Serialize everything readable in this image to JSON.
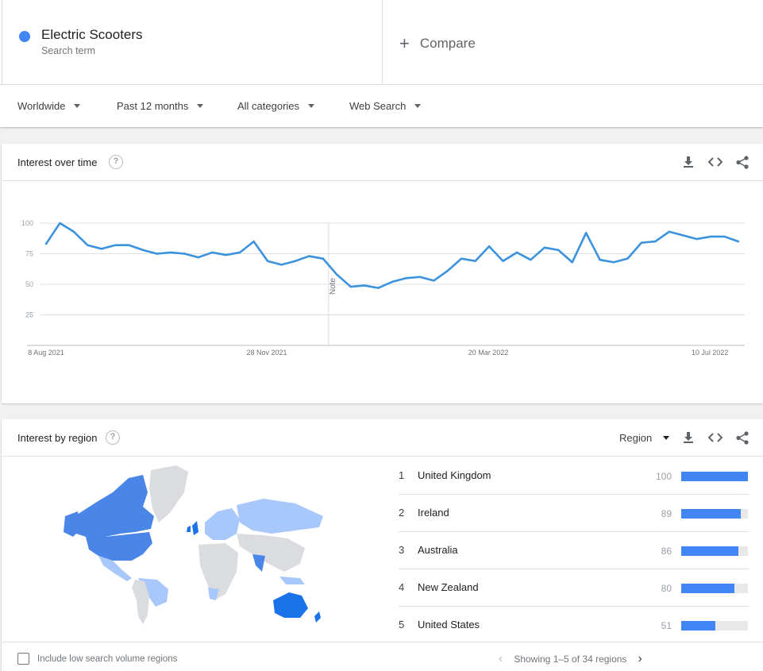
{
  "search_term": {
    "name": "Electric Scooters",
    "subtitle": "Search term",
    "color": "#4285f4"
  },
  "compare": {
    "label": "Compare"
  },
  "filters": {
    "location": "Worldwide",
    "time_range": "Past 12 months",
    "category": "All categories",
    "search_type": "Web Search"
  },
  "interest_over_time": {
    "title": "Interest over time",
    "note_label": "Note",
    "icons": [
      "download-icon",
      "embed-icon",
      "share-icon"
    ]
  },
  "chart_data": {
    "type": "line",
    "title": "",
    "xlabel": "",
    "ylabel": "",
    "ylim": [
      0,
      100
    ],
    "y_ticks": [
      "25",
      "50",
      "75",
      "100"
    ],
    "x_tick_labels": [
      "8 Aug 2021",
      "28 Nov 2021",
      "20 Mar 2022",
      "10 Jul 2022"
    ],
    "x_tick_indices": [
      0,
      16,
      32,
      48
    ],
    "note_index": 20,
    "grid": true,
    "series": [
      {
        "color": "#4285f4",
        "values": [
          83,
          100,
          93,
          82,
          79,
          82,
          82,
          78,
          75,
          76,
          75,
          72,
          76,
          74,
          76,
          85,
          69,
          66,
          69,
          73,
          71,
          58,
          48,
          49,
          47,
          52,
          55,
          56,
          53,
          61,
          71,
          69,
          81,
          69,
          76,
          70,
          80,
          78,
          68,
          92,
          70,
          68,
          71,
          84,
          85,
          93,
          90,
          87,
          89,
          89,
          85
        ]
      }
    ]
  },
  "interest_by_region": {
    "title": "Interest by region",
    "region_select": "Region",
    "icons": [
      "download-icon",
      "embed-icon",
      "share-icon"
    ],
    "map_colors": {
      "strong": "#1a73e8",
      "medium": "#4a86e8",
      "light": "#a8c7fa",
      "none": "#dadce0"
    },
    "rows": [
      {
        "rank": "1",
        "name": "United Kingdom",
        "value": 100
      },
      {
        "rank": "2",
        "name": "Ireland",
        "value": 89
      },
      {
        "rank": "3",
        "name": "Australia",
        "value": 86
      },
      {
        "rank": "4",
        "name": "New Zealand",
        "value": 80
      },
      {
        "rank": "5",
        "name": "United States",
        "value": 51
      }
    ],
    "low_volume_label": "Include low search volume regions",
    "pager_text": "Showing 1–5 of 34 regions"
  }
}
